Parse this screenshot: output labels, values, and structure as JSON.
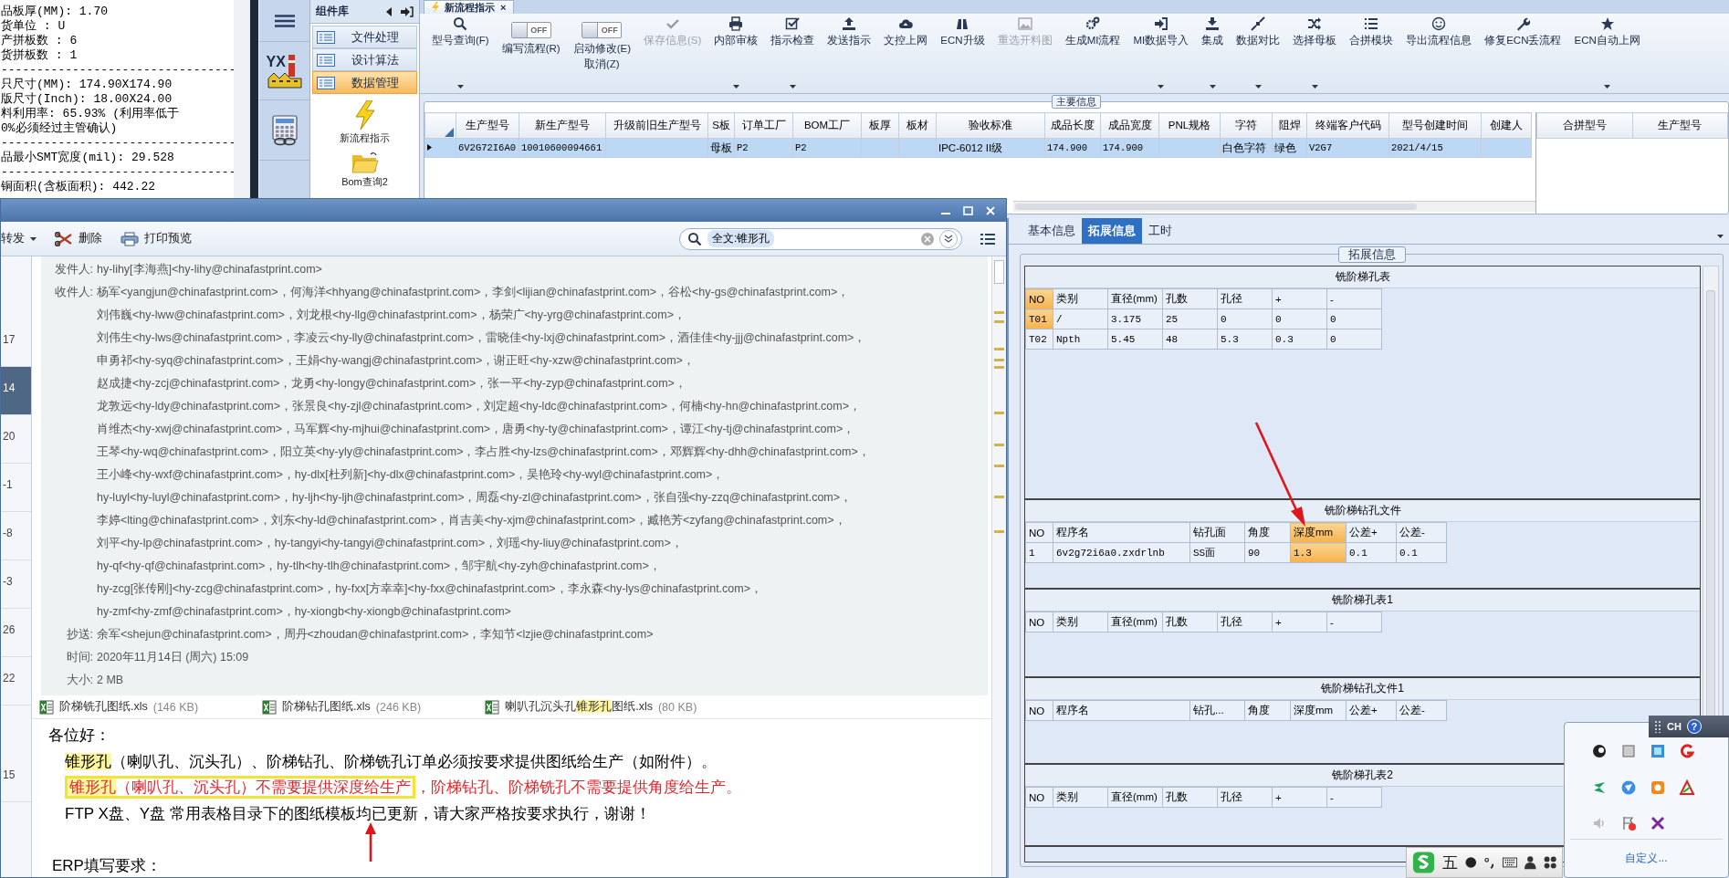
{
  "info_panel": {
    "lines": [
      "品板厚(MM): 1.70",
      "货单位 : U",
      "产拼板数 : 6",
      "货拼板数 : 1",
      "---------------------------------",
      "只尺寸(MM): 174.90X174.90",
      "版尺寸(Inch): 18.00X24.00",
      "料利用率: 65.93% (利用率低于",
      "0%必须经过主管确认)",
      "---------------------------------",
      "品最小SMT宽度(mil): 29.528",
      "---------------------------------",
      "铜面积(含板面积): 442.22"
    ]
  },
  "nav_rail": {
    "logo_text": "YX"
  },
  "component_library": {
    "title": "组件库",
    "groups": [
      {
        "label": "文件处理",
        "selected": false
      },
      {
        "label": "设计算法",
        "selected": false
      },
      {
        "label": "数据管理",
        "selected": true
      }
    ],
    "items": [
      {
        "label": "新流程指示"
      },
      {
        "label": "Bom查询2"
      }
    ]
  },
  "document_tab": {
    "title": "新流程指示",
    "close": "×"
  },
  "toolbar": [
    {
      "kind": "button",
      "label": "型号查询(F)",
      "dropdown": true,
      "disabled": false
    },
    {
      "kind": "switch",
      "switch_text": "OFF",
      "on": false,
      "label": "编写流程(R)"
    },
    {
      "kind": "switch",
      "switch_text": "OFF",
      "on": false,
      "label": "启动修改(E)",
      "sublabel": "取消(Z)"
    },
    {
      "kind": "button",
      "label": "保存信息(S)",
      "dropdown": false,
      "disabled": true
    },
    {
      "kind": "button",
      "label": "内部审核",
      "dropdown": true,
      "disabled": false
    },
    {
      "kind": "button",
      "label": "指示检查",
      "dropdown": true,
      "disabled": false
    },
    {
      "kind": "button",
      "label": "发送指示",
      "dropdown": false,
      "disabled": false
    },
    {
      "kind": "button",
      "label": "文控上网",
      "dropdown": false,
      "disabled": false
    },
    {
      "kind": "button",
      "label": "ECN升级",
      "dropdown": false,
      "disabled": false
    },
    {
      "kind": "button",
      "label": "重选开料图",
      "dropdown": false,
      "disabled": true
    },
    {
      "kind": "button",
      "label": "生成MI流程",
      "dropdown": false,
      "disabled": false
    },
    {
      "kind": "button",
      "label": "MI数据导入",
      "dropdown": true,
      "disabled": false
    },
    {
      "kind": "button",
      "label": "集成",
      "dropdown": true,
      "disabled": false
    },
    {
      "kind": "button",
      "label": "数据对比",
      "dropdown": true,
      "disabled": false
    },
    {
      "kind": "button",
      "label": "选择母板",
      "dropdown": true,
      "disabled": false
    },
    {
      "kind": "button",
      "label": "合拼模块",
      "dropdown": false,
      "disabled": false
    },
    {
      "kind": "button",
      "label": "导出流程信息",
      "dropdown": false,
      "disabled": false
    },
    {
      "kind": "button",
      "label": "修复ECN丢流程",
      "dropdown": false,
      "disabled": false
    },
    {
      "kind": "button",
      "label": "ECN自动上网",
      "dropdown": true,
      "disabled": false
    }
  ],
  "main_info": {
    "legend": "主要信息",
    "table": {
      "columns": [
        "生产型号",
        "新生产型号",
        "升级前旧生产型号",
        "S板",
        "订单工厂",
        "BOM工厂",
        "板厚",
        "板材",
        "验收标准",
        "成品长度",
        "成品宽度",
        "PNL规格",
        "字符",
        "阻焊",
        "终端客户代码",
        "型号创建时间",
        "创建人"
      ],
      "rows": [
        {
          "selected": true,
          "cells": [
            "6V2G72I6A0",
            "10010600094661",
            null,
            "母板",
            "P2",
            "P2",
            null,
            null,
            "IPC-6012 II级",
            "174.900",
            "174.900",
            null,
            "白色字符",
            "绿色",
            "V2G7",
            "2021/4/15",
            null
          ]
        }
      ]
    },
    "side_table": {
      "columns": [
        "合拼型号",
        "生产型号"
      ]
    }
  },
  "detail_panel": {
    "tabs": [
      {
        "label": "基本信息",
        "selected": false
      },
      {
        "label": "拓展信息",
        "selected": true
      },
      {
        "label": "工时",
        "selected": false
      }
    ],
    "legend": "拓展信息",
    "sections": [
      {
        "title": "铣阶梯孔表",
        "kind": "hole",
        "columns": [
          {
            "label": "NO",
            "selected": true
          },
          {
            "label": "类别",
            "selected": false
          },
          {
            "label": "直径(mm)",
            "selected": false
          },
          {
            "label": "孔数",
            "selected": false
          },
          {
            "label": "孔径",
            "selected": false
          },
          {
            "label": "+",
            "selected": false
          },
          {
            "label": "-",
            "selected": false
          }
        ],
        "rows": [
          {
            "selected": true,
            "cells": [
              "T01",
              "/",
              "3.175",
              "25",
              "0",
              "0",
              "0"
            ]
          },
          {
            "selected": false,
            "cells": [
              "T02",
              "Npth",
              "5.45",
              "48",
              "5.3",
              "0.3",
              "0"
            ]
          }
        ]
      },
      {
        "title": "铣阶梯钻孔文件",
        "kind": "drill",
        "columns": [
          {
            "label": "NO",
            "selected": false
          },
          {
            "label": "程序名",
            "selected": false
          },
          {
            "label": "钻孔面",
            "selected": false
          },
          {
            "label": "角度",
            "selected": false
          },
          {
            "label": "深度mm",
            "selected": true
          },
          {
            "label": "公差+",
            "selected": false
          },
          {
            "label": "公差-",
            "selected": false
          }
        ],
        "rows": [
          {
            "selected": true,
            "cells": [
              "1",
              "6v2g72i6a0.zxdrlnb",
              "SS面",
              "90",
              "1.3",
              "0.1",
              "0.1"
            ]
          }
        ]
      },
      {
        "title": "铣阶梯孔表1",
        "kind": "hole",
        "columns": [
          {
            "label": "NO",
            "selected": false
          },
          {
            "label": "类别",
            "selected": false
          },
          {
            "label": "直径(mm)",
            "selected": false
          },
          {
            "label": "孔数",
            "selected": false
          },
          {
            "label": "孔径",
            "selected": false
          },
          {
            "label": "+",
            "selected": false
          },
          {
            "label": "-",
            "selected": false
          }
        ]
      },
      {
        "title": "铣阶梯钻孔文件1",
        "kind": "drill",
        "columns": [
          {
            "label": "NO",
            "selected": false
          },
          {
            "label": "程序名",
            "selected": false
          },
          {
            "label": "钻孔...",
            "selected": false
          },
          {
            "label": "角度",
            "selected": false
          },
          {
            "label": "深度mm",
            "selected": false
          },
          {
            "label": "公差+",
            "selected": false
          },
          {
            "label": "公差-",
            "selected": false
          }
        ]
      },
      {
        "title": "铣阶梯孔表2",
        "kind": "hole",
        "columns": [
          {
            "label": "NO",
            "selected": false
          },
          {
            "label": "类别",
            "selected": false
          },
          {
            "label": "直径(mm)",
            "selected": false
          },
          {
            "label": "孔数",
            "selected": false
          },
          {
            "label": "孔径",
            "selected": false
          },
          {
            "label": "+",
            "selected": false
          },
          {
            "label": "-",
            "selected": false
          }
        ]
      }
    ]
  },
  "mail_window": {
    "toolbar": [
      {
        "label": "转发",
        "dropdown": true
      },
      {
        "label": "删除",
        "dropdown": false
      },
      {
        "label": "打印预览",
        "dropdown": false
      }
    ],
    "search": {
      "value": "全文:锥形孔"
    },
    "list": [
      {
        "text": "17",
        "selected": false
      },
      {
        "text": "14",
        "selected": true
      },
      {
        "text": "20",
        "selected": false
      },
      {
        "text": "-1",
        "selected": false
      },
      {
        "text": "-8",
        "selected": false
      },
      {
        "text": "-3",
        "selected": false
      },
      {
        "text": "26",
        "selected": false
      },
      {
        "text": "22",
        "selected": false
      },
      {
        "text": "15",
        "selected": false
      }
    ],
    "header": [
      {
        "label": "发件人:",
        "lines": [
          "hy-lihy[李海燕]<hy-lihy@chinafastprint.com>"
        ]
      },
      {
        "label": "收件人:",
        "lines": [
          "杨军<yangjun@chinafastprint.com>，何海洋<hhyang@chinafastprint.com>，李剑<lijian@chinafastprint.com>，谷松<hy-gs@chinafastprint.com>，",
          "刘伟巍<hy-lww@chinafastprint.com>，刘龙根<hy-llg@chinafastprint.com>，杨荣广<hy-yrg@chinafastprint.com>，",
          "刘伟生<hy-lws@chinafastprint.com>，李凌云<hy-lly@chinafastprint.com>，雷晓佳<hy-lxj@chinafastprint.com>，酒佳佳<hy-jjj@chinafastprint.com>，",
          "申勇祁<hy-syq@chinafastprint.com>，王娟<hy-wangj@chinafastprint.com>，谢正旺<hy-xzw@chinafastprint.com>，",
          "赵成捷<hy-zcj@chinafastprint.com>，龙勇<hy-longy@chinafastprint.com>，张一平<hy-zyp@chinafastprint.com>，",
          "龙敦远<hy-ldy@chinafastprint.com>，张景良<hy-zjl@chinafastprint.com>，刘定超<hy-ldc@chinafastprint.com>，何楠<hy-hn@chinafastprint.com>，",
          "肖维杰<hy-xwj@chinafastprint.com>，马军辉<hy-mjhui@chinafastprint.com>，唐勇<hy-ty@chinafastprint.com>，谭江<hy-tj@chinafastprint.com>，",
          "王琴<hy-wq@chinafastprint.com>，阳立英<hy-yly@chinafastprint.com>，李占胜<hy-lzs@chinafastprint.com>，邓辉辉<hy-dhh@chinafastprint.com>，",
          "王小峰<hy-wxf@chinafastprint.com>，hy-dlx[杜列新]<hy-dlx@chinafastprint.com>，吴艳玲<hy-wyl@chinafastprint.com>，",
          "hy-luyl<hy-luyl@chinafastprint.com>，hy-ljh<hy-ljh@chinafastprint.com>，周磊<hy-zl@chinafastprint.com>，张自强<hy-zzq@chinafastprint.com>，",
          "李婷<lting@chinafastprint.com>，刘东<hy-ld@chinafastprint.com>，肖吉美<hy-xjm@chinafastprint.com>，臧艳芳<zyfang@chinafastprint.com>，",
          "刘平<hy-lp@chinafastprint.com>，hy-tangyi<hy-tangyi@chinafastprint.com>，刘瑶<hy-liuy@chinafastprint.com>，",
          "hy-qf<hy-qf@chinafastprint.com>，hy-tlh<hy-tlh@chinafastprint.com>，邹宇航<hy-zyh@chinafastprint.com>，",
          "hy-zcg[张传刚]<hy-zcg@chinafastprint.com>，hy-fxx[方幸幸]<hy-fxx@chinafastprint.com>，李永森<hy-lys@chinafastprint.com>，",
          "hy-zmf<hy-zmf@chinafastprint.com>，hy-xiongb<hy-xiongb@chinafastprint.com>"
        ]
      },
      {
        "label": "抄送:",
        "lines": [
          "余军<shejun@chinafastprint.com>，周丹<zhoudan@chinafastprint.com>，李知节<lzjie@chinafastprint.com>"
        ]
      },
      {
        "label": "时间:",
        "lines": [
          "2020年11月14日 (周六) 15:09"
        ]
      },
      {
        "label": "大小:",
        "lines": [
          "2 MB"
        ]
      }
    ],
    "attachments": [
      {
        "name": [
          {
            "text": "阶梯铣孔图纸.xls",
            "highlight": false
          }
        ],
        "size": "(146 KB)"
      },
      {
        "name": [
          {
            "text": "阶梯钻孔图纸.xls",
            "highlight": false
          }
        ],
        "size": "(246 KB)"
      },
      {
        "name": [
          {
            "text": "喇叭孔沉头孔",
            "highlight": false
          },
          {
            "text": "锥形孔",
            "highlight": true
          },
          {
            "text": "图纸.xls",
            "highlight": false
          }
        ],
        "size": "(80 KB)"
      }
    ],
    "body": [
      {
        "kind": "greeting",
        "segments": [
          {
            "text": "各位好：",
            "highlight": false,
            "framed": false,
            "alert": false
          }
        ]
      },
      {
        "kind": "point",
        "segments": [
          {
            "text": "锥形孔",
            "highlight": true,
            "framed": false,
            "alert": false
          },
          {
            "text": "（喇叭孔、沉头孔）、阶梯钻孔、阶梯铣孔订单必须按要求提供图纸给生产（如附件）。",
            "highlight": false,
            "framed": false,
            "alert": false
          }
        ]
      },
      {
        "kind": "point",
        "segments": [
          {
            "text": "锥形孔",
            "highlight": true,
            "framed": true,
            "alert": true
          },
          {
            "text": "（喇叭孔、沉头孔）不需要提供深度给生产",
            "highlight": false,
            "framed": true,
            "alert": true
          },
          {
            "text": "，阶梯钻孔、阶梯铣孔不需要提供角度给生产。",
            "highlight": false,
            "framed": false,
            "alert": true
          }
        ]
      },
      {
        "kind": "point",
        "segments": [
          {
            "text": "FTP X盘、Y盘 常用表格目录下的图纸模板均已更新，请大家严格按要求执行，谢谢！",
            "highlight": false,
            "framed": false,
            "alert": false
          }
        ]
      },
      {
        "kind": "heading",
        "segments": [
          {
            "text": "ERP填写要求：",
            "highlight": false,
            "framed": false,
            "alert": false
          }
        ]
      }
    ]
  },
  "tray": {
    "language": "CH",
    "help": "?",
    "link": "自定义..."
  },
  "ime": {
    "mode": "五"
  }
}
